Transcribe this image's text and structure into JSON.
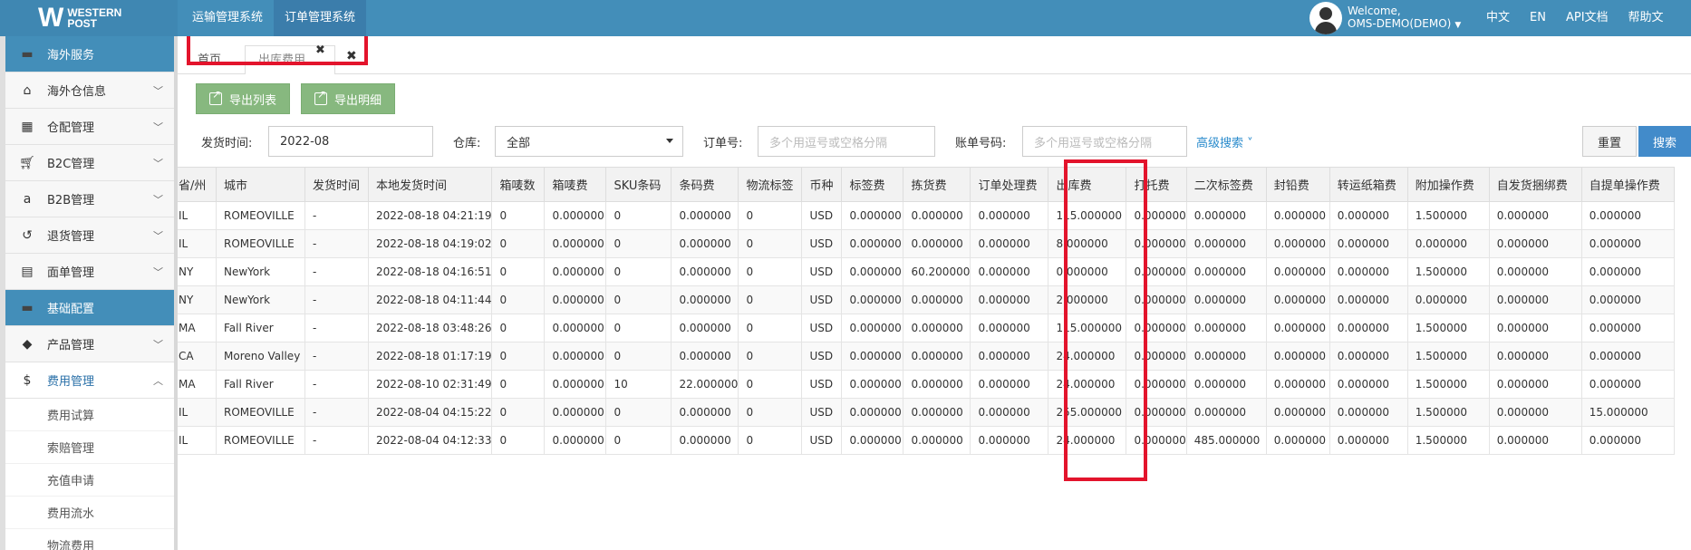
{
  "topbar": {
    "logo_mark": "W",
    "logo_line1": "WESTERN",
    "logo_line2": "POST",
    "nav": [
      "运输管理系统",
      "订单管理系统"
    ],
    "welcome": "Welcome,",
    "user": "OMS-DEMO(DEMO)",
    "links": [
      "中文",
      "EN",
      "API文档",
      "帮助文"
    ]
  },
  "sidebar": {
    "items": [
      {
        "label": "海外服务",
        "icon": "folder-icon",
        "type": "section"
      },
      {
        "label": "海外仓信息",
        "icon": "home-icon",
        "type": "item"
      },
      {
        "label": "仓配管理",
        "icon": "grid-icon",
        "type": "item"
      },
      {
        "label": "B2C管理",
        "icon": "cart-icon",
        "type": "item"
      },
      {
        "label": "B2B管理",
        "icon": "amazon-icon",
        "type": "item"
      },
      {
        "label": "退货管理",
        "icon": "undo-icon",
        "type": "item"
      },
      {
        "label": "面单管理",
        "icon": "document-icon",
        "type": "item"
      },
      {
        "label": "基础配置",
        "icon": "folder-icon",
        "type": "section"
      },
      {
        "label": "产品管理",
        "icon": "tag-icon",
        "type": "item"
      },
      {
        "label": "费用管理",
        "icon": "dollar-icon",
        "type": "open"
      }
    ],
    "subitems": [
      "费用试算",
      "索赔管理",
      "充值申请",
      "费用流水",
      "物流费用"
    ]
  },
  "tabs": {
    "home": "首页",
    "active": "出库费用",
    "close": "✖",
    "close_all": "✖"
  },
  "toolbar": {
    "export_list": "导出列表",
    "export_detail": "导出明细"
  },
  "filters": {
    "ship_time_label": "发货时间:",
    "ship_time_value": "2022-08",
    "warehouse_label": "仓库:",
    "warehouse_value": "全部",
    "order_label": "订单号:",
    "order_placeholder": "多个用逗号或空格分隔",
    "bill_label": "账单号码:",
    "bill_placeholder": "多个用逗号或空格分隔",
    "advanced": "高级搜索",
    "reset": "重置",
    "search": "搜索"
  },
  "table": {
    "headers": [
      "省/州",
      "城市",
      "发货时间",
      "本地发货时间",
      "箱唛数",
      "箱唛费",
      "SKU条码",
      "条码费",
      "物流标签",
      "币种",
      "标签费",
      "拣货费",
      "订单处理费",
      "出库费",
      "打托费",
      "二次标签费",
      "封铅费",
      "转运纸箱费",
      "附加操作费",
      "自发货捆绑费",
      "自提单操作费"
    ],
    "rows": [
      [
        "IL",
        "ROMEOVILLE",
        "-",
        "2022-08-18 04:21:19",
        "0",
        "0.000000",
        "0",
        "0.000000",
        "0",
        "USD",
        "0.000000",
        "0.000000",
        "0.000000",
        "115.000000",
        "0.000000",
        "0.000000",
        "0.000000",
        "0.000000",
        "1.500000",
        "0.000000",
        "0.000000"
      ],
      [
        "IL",
        "ROMEOVILLE",
        "-",
        "2022-08-18 04:19:02",
        "0",
        "0.000000",
        "0",
        "0.000000",
        "0",
        "USD",
        "0.000000",
        "0.000000",
        "0.000000",
        "8.000000",
        "0.000000",
        "0.000000",
        "0.000000",
        "0.000000",
        "0.000000",
        "0.000000",
        "0.000000"
      ],
      [
        "NY",
        "NewYork",
        "-",
        "2022-08-18 04:16:51",
        "0",
        "0.000000",
        "0",
        "0.000000",
        "0",
        "USD",
        "0.000000",
        "60.200000",
        "0.000000",
        "0.000000",
        "0.000000",
        "0.000000",
        "0.000000",
        "0.000000",
        "1.500000",
        "0.000000",
        "0.000000"
      ],
      [
        "NY",
        "NewYork",
        "-",
        "2022-08-18 04:11:44",
        "0",
        "0.000000",
        "0",
        "0.000000",
        "0",
        "USD",
        "0.000000",
        "0.000000",
        "0.000000",
        "2.000000",
        "0.000000",
        "0.000000",
        "0.000000",
        "0.000000",
        "0.000000",
        "0.000000",
        "0.000000"
      ],
      [
        "MA",
        "Fall River",
        "-",
        "2022-08-18 03:48:26",
        "0",
        "0.000000",
        "0",
        "0.000000",
        "0",
        "USD",
        "0.000000",
        "0.000000",
        "0.000000",
        "115.000000",
        "0.000000",
        "0.000000",
        "0.000000",
        "0.000000",
        "1.500000",
        "0.000000",
        "0.000000"
      ],
      [
        "CA",
        "Moreno Valley",
        "-",
        "2022-08-18 01:17:19",
        "0",
        "0.000000",
        "0",
        "0.000000",
        "0",
        "USD",
        "0.000000",
        "0.000000",
        "0.000000",
        "24.000000",
        "0.000000",
        "0.000000",
        "0.000000",
        "0.000000",
        "1.500000",
        "0.000000",
        "0.000000"
      ],
      [
        "MA",
        "Fall River",
        "-",
        "2022-08-10 02:31:49",
        "0",
        "0.000000",
        "10",
        "22.000000",
        "0",
        "USD",
        "0.000000",
        "0.000000",
        "0.000000",
        "24.000000",
        "0.000000",
        "0.000000",
        "0.000000",
        "0.000000",
        "1.500000",
        "0.000000",
        "0.000000"
      ],
      [
        "IL",
        "ROMEOVILLE",
        "-",
        "2022-08-04 04:15:22",
        "0",
        "0.000000",
        "0",
        "0.000000",
        "0",
        "USD",
        "0.000000",
        "0.000000",
        "0.000000",
        "255.000000",
        "0.000000",
        "0.000000",
        "0.000000",
        "0.000000",
        "1.500000",
        "0.000000",
        "15.000000"
      ],
      [
        "IL",
        "ROMEOVILLE",
        "-",
        "2022-08-04 04:12:33",
        "0",
        "0.000000",
        "0",
        "0.000000",
        "0",
        "USD",
        "0.000000",
        "0.000000",
        "0.000000",
        "24.000000",
        "0.000000",
        "485.000000",
        "0.000000",
        "0.000000",
        "1.500000",
        "0.000000",
        "0.000000"
      ]
    ]
  },
  "colors": {
    "topbar": "#438eb9",
    "section": "#438eb9",
    "export_button": "#87b87f",
    "search_button": "#428bca",
    "annotation": "#e3142c"
  }
}
